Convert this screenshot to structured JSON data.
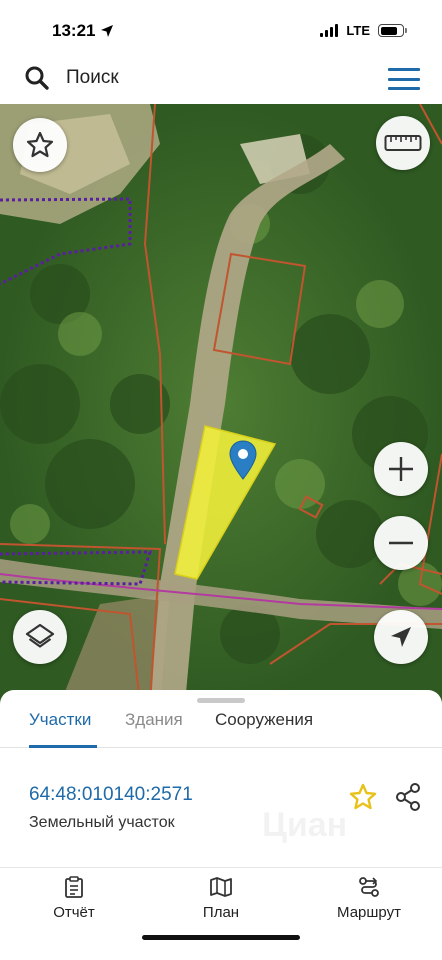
{
  "status": {
    "time": "13:21",
    "network": "LTE"
  },
  "search": {
    "placeholder": "Поиск"
  },
  "map": {
    "buttons": [
      "star-icon",
      "ruler-icon",
      "zoom-in-icon",
      "zoom-out-icon",
      "layers-icon",
      "locate-arrow-icon"
    ],
    "selected_parcel_color": "#f3f03a",
    "boundary_color": "#c0552f",
    "dotted_boundary_color": "#5a1fa0"
  },
  "sheet": {
    "tabs": [
      {
        "label": "Участки",
        "active": true
      },
      {
        "label": "Здания",
        "active": false
      },
      {
        "label": "Сооружения",
        "active": false
      }
    ],
    "parcel": {
      "cadastral_number": "64:48:010140:2571",
      "type": "Земельный участок"
    }
  },
  "nav": {
    "items": [
      {
        "label": "Отчёт",
        "icon": "report-icon"
      },
      {
        "label": "План",
        "icon": "map-plan-icon"
      },
      {
        "label": "Маршрут",
        "icon": "route-icon"
      }
    ]
  },
  "colors": {
    "accent": "#1f6aa8",
    "star": "#e8c21a"
  }
}
